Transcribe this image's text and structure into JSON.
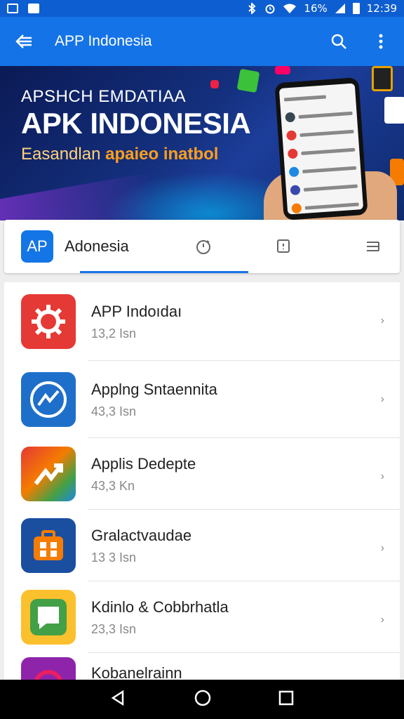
{
  "status_bar": {
    "battery_text": "16%",
    "time": "12:39"
  },
  "app_bar": {
    "title": "APP Indonesia",
    "back_icon": "arrow-back-icon",
    "search_icon": "search-icon",
    "menu_icon": "more-vert-icon"
  },
  "banner": {
    "line1": "APSHCH EMDATIAA",
    "line2": "APK INDONESIA",
    "line3_a": "Easandlan",
    "line3_b": "apaieo",
    "line3_c": "inatbol"
  },
  "tabs": {
    "logo_text": "AP",
    "app_name": "Adonesia",
    "icons": [
      "timer-icon",
      "bookmark-icon",
      "list-icon"
    ]
  },
  "apps": [
    {
      "name": "APP Indoıdaı",
      "size": "13,2 Isn",
      "icon": "gear-icon",
      "color": "#e53935"
    },
    {
      "name": "Applng Sntaennita",
      "size": "43,3 Isn",
      "icon": "chart-icon",
      "color": "#1e6fc9"
    },
    {
      "name": "Applis Dedepte",
      "size": "43,3 Kn",
      "icon": "arrow-icon",
      "color": "#f57c00"
    },
    {
      "name": "Gralactvaudae",
      "size": "13 3 Isn",
      "icon": "briefcase-icon",
      "color": "#1a4fa0"
    },
    {
      "name": "Kdinlo & Cobbrhatla",
      "size": "23,3 Isn",
      "icon": "chat-icon",
      "color": "#fbc02d"
    },
    {
      "name": "Kobanelrainn",
      "size": "",
      "icon": "circle-icon",
      "color": "#8e24aa"
    }
  ],
  "nav": {
    "back": "nav-back-icon",
    "home": "nav-home-icon",
    "recents": "nav-recents-icon"
  }
}
